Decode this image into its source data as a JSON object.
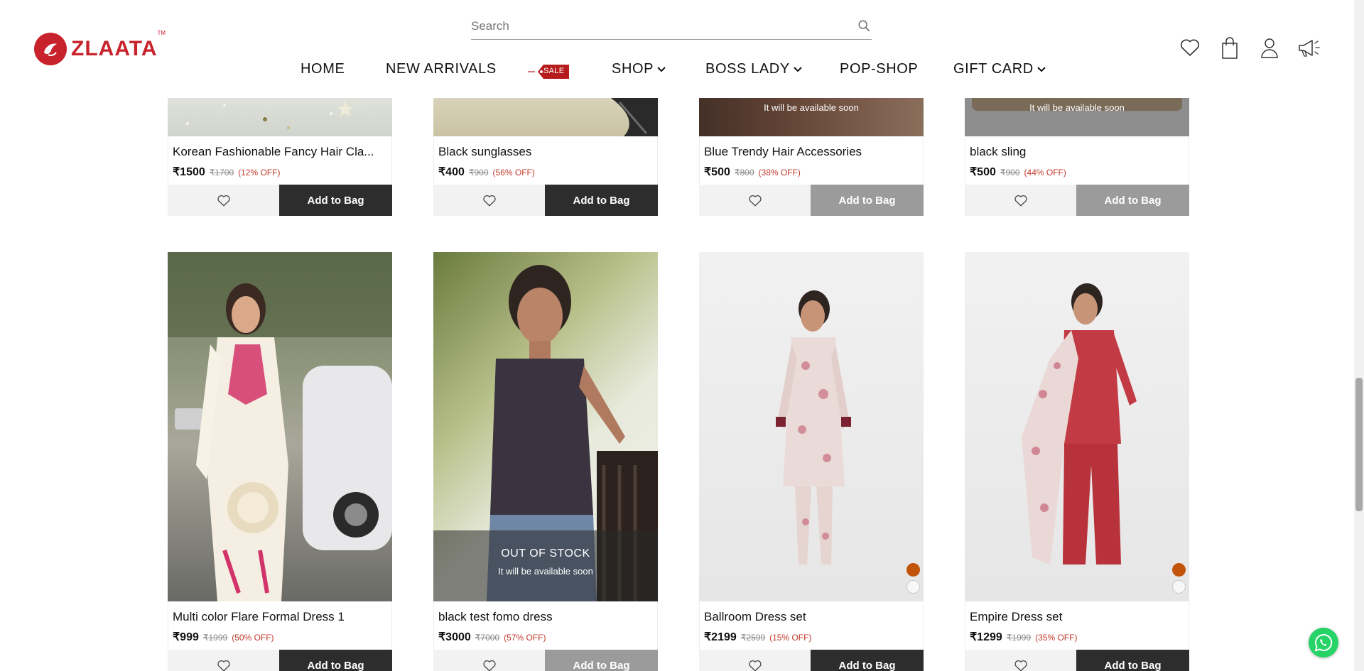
{
  "header": {
    "logo_text": "ZLAATA",
    "logo_tm": "TM",
    "search_placeholder": "Search",
    "nav": {
      "home": "HOME",
      "new_arrivals": "NEW ARRIVALS",
      "sale_badge": "SALE",
      "shop": "SHOP",
      "boss_lady": "BOSS LADY",
      "pop_shop": "POP-SHOP",
      "gift_card": "GIFT CARD"
    },
    "icons": [
      "heart-icon",
      "shopping-bag-icon",
      "user-icon",
      "megaphone-icon"
    ]
  },
  "labels": {
    "add_to_bag": "Add to Bag",
    "available_soon": "It will be available soon",
    "out_of_stock": "OUT OF STOCK"
  },
  "row1": [
    {
      "title": "Korean Fashionable Fancy Hair Cla...",
      "price": "₹1500",
      "mrp": "₹1700",
      "off": "(12% OFF)",
      "available": true
    },
    {
      "title": "Black sunglasses",
      "price": "₹400",
      "mrp": "₹900",
      "off": "(56% OFF)",
      "available": true
    },
    {
      "title": "Blue Trendy Hair Accessories",
      "price": "₹500",
      "mrp": "₹800",
      "off": "(38% OFF)",
      "available": false
    },
    {
      "title": "black sling",
      "price": "₹500",
      "mrp": "₹900",
      "off": "(44% OFF)",
      "available": false
    }
  ],
  "row2": [
    {
      "title": "Multi color Flare Formal Dress 1",
      "price": "₹999",
      "mrp": "₹1999",
      "off": "(50% OFF)",
      "available": true
    },
    {
      "title": "black test fomo dress",
      "price": "₹3000",
      "mrp": "₹7000",
      "off": "(57% OFF)",
      "available": false
    },
    {
      "title": "Ballroom Dress set",
      "price": "₹2199",
      "mrp": "₹2599",
      "off": "(15% OFF)",
      "available": true
    },
    {
      "title": "Empire Dress set",
      "price": "₹1299",
      "mrp": "₹1999",
      "off": "(35% OFF)",
      "available": true
    }
  ],
  "colors": {
    "brand": "#c8232c",
    "dark_button": "#2d2d2d",
    "disabled_button": "#9b9b9b",
    "discount": "#c0392b",
    "swatch_orange": "#c2530a"
  }
}
